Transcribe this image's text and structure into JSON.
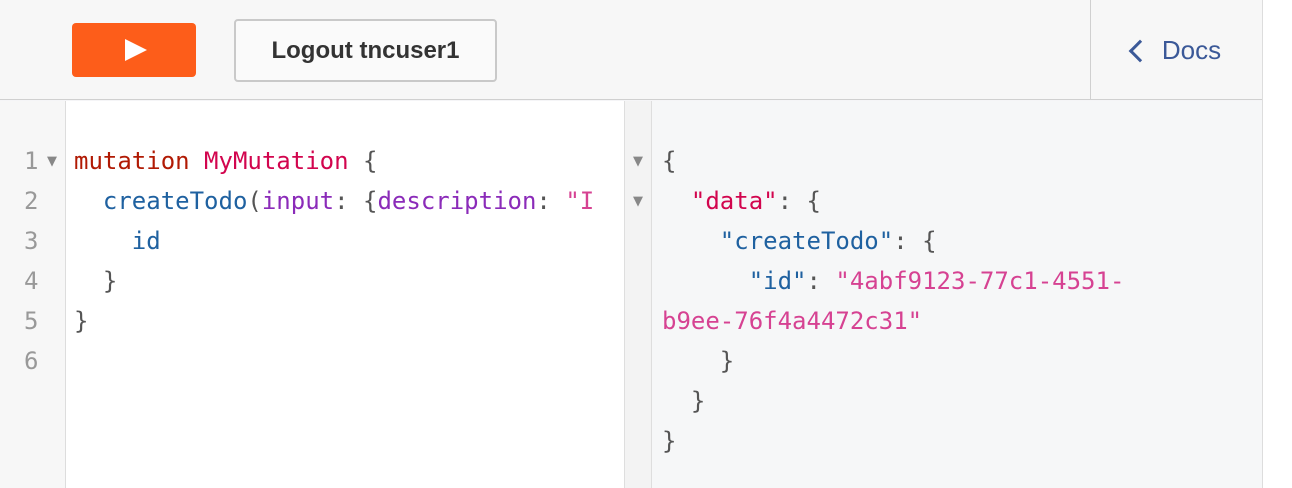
{
  "toolbar": {
    "run_icon": "play-icon",
    "logout_label": "Logout tncuser1",
    "docs_label": "Docs",
    "docs_icon": "chevron-left-icon",
    "accent": "#fd5d1a"
  },
  "editor": {
    "line_numbers": [
      "1",
      "2",
      "3",
      "4",
      "5",
      "6"
    ],
    "line1": {
      "keyword": "mutation",
      "name": "MyMutation",
      "brace": " {"
    },
    "line2": {
      "field": "createTodo",
      "paren": "(",
      "arg": "input",
      "colon": ": {",
      "arg2": "description",
      "colon2": ": ",
      "str": "\"I"
    },
    "line3": {
      "field": "id"
    },
    "line4": {
      "brace": "}"
    },
    "line5": {
      "brace": "}"
    }
  },
  "result": {
    "open": "{",
    "data_key": "\"data\"",
    "data_colon": ": {",
    "createTodo_key": "\"createTodo\"",
    "createTodo_colon": ": {",
    "id_key": "\"id\"",
    "id_colon": ": ",
    "id_value_part1": "\"4abf9123-77c1-4551-",
    "id_value_part2": "b9ee-76f4a4472c31\"",
    "close3": "}",
    "close2": "}",
    "close1": "}"
  }
}
